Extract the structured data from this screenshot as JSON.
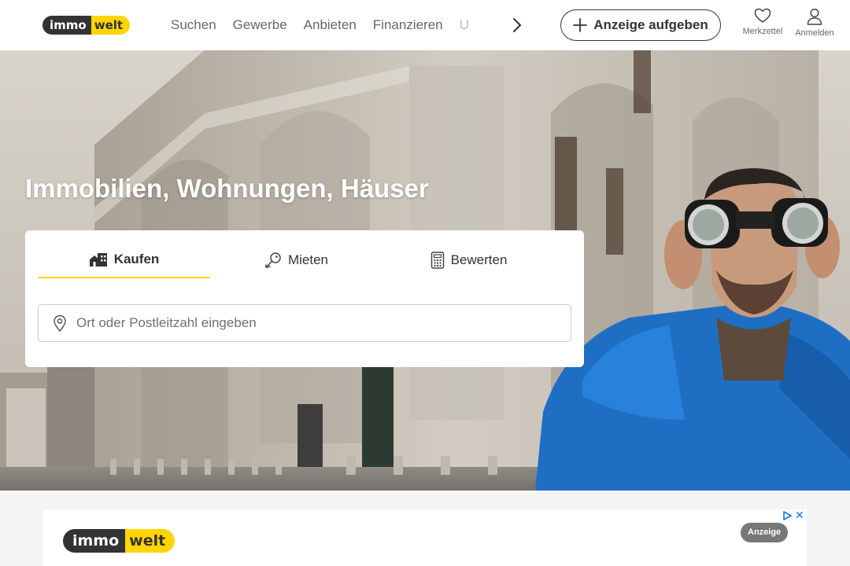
{
  "header": {
    "logo": {
      "left": "immo",
      "right": "welt"
    },
    "nav": [
      "Suchen",
      "Gewerbe",
      "Anbieten",
      "Finanzieren",
      "U"
    ],
    "post_ad_label": "Anzeige aufgeben",
    "watchlist_label": "Merkzettel",
    "login_label": "Anmelden"
  },
  "hero": {
    "title": "Immobilien, Wohnungen, Häuser"
  },
  "search": {
    "tabs": [
      {
        "label": "Kaufen",
        "icon": "house-icon",
        "active": true
      },
      {
        "label": "Mieten",
        "icon": "key-icon",
        "active": false
      },
      {
        "label": "Bewerten",
        "icon": "calculator-icon",
        "active": false
      }
    ],
    "placeholder": "Ort oder Postleitzahl eingeben"
  },
  "ad": {
    "logo": {
      "left": "immo",
      "right": "welt"
    },
    "badge": "Anzeige",
    "close": "✕"
  },
  "colors": {
    "brand_yellow": "#ffd500",
    "brand_dark": "#333333",
    "jacket_blue": "#1e6fc4"
  }
}
